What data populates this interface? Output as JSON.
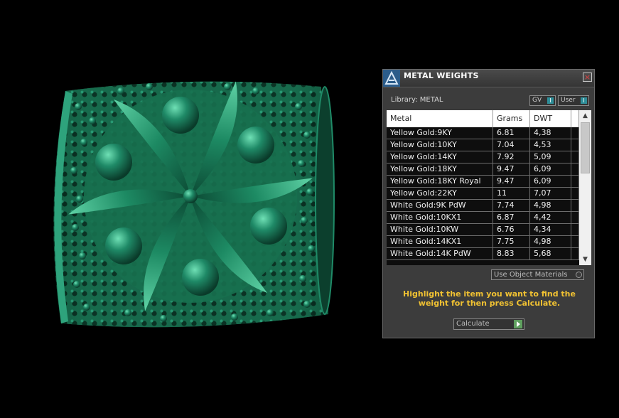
{
  "viewport": {
    "object": "ring-model",
    "color": "#1f8a67"
  },
  "panel": {
    "title": "METAL WEIGHTS",
    "close_label": "×",
    "library_label": "Library: METAL",
    "toggles": [
      {
        "label": "GV",
        "knob": "I"
      },
      {
        "label": "User",
        "knob": "I"
      }
    ],
    "columns": [
      "Metal",
      "Grams",
      "DWT"
    ],
    "rows": [
      {
        "metal": "Yellow Gold:9KY",
        "grams": "6.81",
        "dwt": "4,38"
      },
      {
        "metal": "Yellow Gold:10KY",
        "grams": "7.04",
        "dwt": "4,53"
      },
      {
        "metal": "Yellow Gold:14KY",
        "grams": "7.92",
        "dwt": "5,09"
      },
      {
        "metal": "Yellow Gold:18KY",
        "grams": "9.47",
        "dwt": "6,09"
      },
      {
        "metal": "Yellow Gold:18KY Royal",
        "grams": "9.47",
        "dwt": "6,09"
      },
      {
        "metal": "Yellow Gold:22KY",
        "grams": "11",
        "dwt": "7,07"
      },
      {
        "metal": "White Gold:9K PdW",
        "grams": "7.74",
        "dwt": "4,98"
      },
      {
        "metal": "White Gold:10KX1",
        "grams": "6.87",
        "dwt": "4,42"
      },
      {
        "metal": "White Gold:10KW",
        "grams": "6.76",
        "dwt": "4,34"
      },
      {
        "metal": "White Gold:14KX1",
        "grams": "7.75",
        "dwt": "4,98"
      },
      {
        "metal": "White Gold:14K PdW",
        "grams": "8.83",
        "dwt": "5,68"
      }
    ],
    "scroll_up": "▲",
    "scroll_down": "▼",
    "use_object_materials": "Use Object Materials",
    "hint": "Highlight the item you want to find the weight for then press Calculate.",
    "calculate_label": "Calculate"
  }
}
